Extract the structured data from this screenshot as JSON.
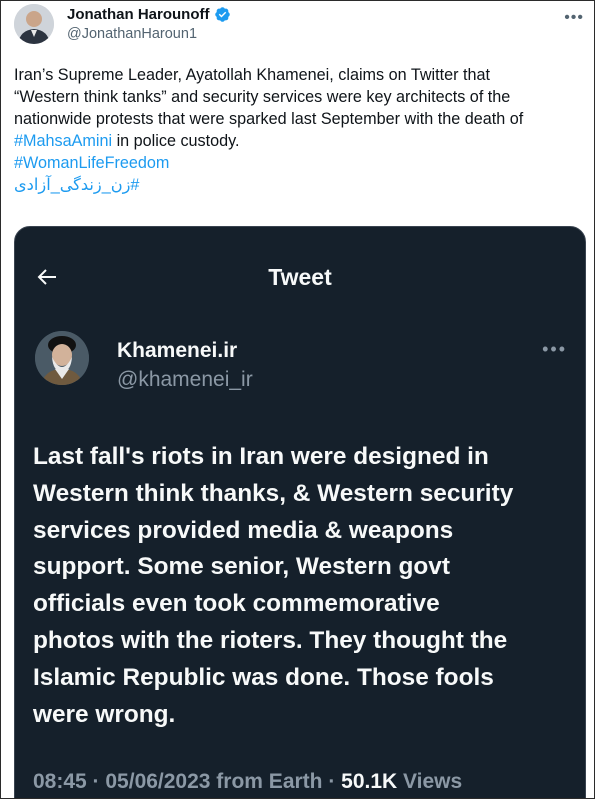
{
  "outer_tweet": {
    "display_name": "Jonathan Harounoff",
    "handle": "@JonathanHaroun1",
    "more_icon": "more-icon",
    "verified_icon": "verified-badge-icon",
    "verified_color": "#1d9bf0",
    "text_lines": [
      "Iran’s Supreme Leader, Ayatollah Khamenei, claims on Twitter that",
      "“Western think tanks” and security services were key architects of the",
      "nationwide protests that were sparked last September with the death of"
    ],
    "line4_hashtag": "#MahsaAmini",
    "line4_rest": " in police custody.",
    "hashtag_2": "#WomanLifeFreedom",
    "hashtag_3": "#زن_زندگی_آزادی"
  },
  "embedded_tweet": {
    "header_title": "Tweet",
    "back_icon": "back-arrow-icon",
    "display_name": "Khamenei.ir",
    "handle": "@khamenei_ir",
    "text_lines": [
      "Last fall's riots in Iran were designed in",
      "Western think thanks, & Western security",
      "services provided media & weapons",
      "support. Some senior, Western govt",
      "officials even took commemorative",
      "photos with the rioters. They thought the",
      "Islamic Republic was done. Those fools",
      "were wrong."
    ],
    "meta_prefix": "08:45 · 05/06/2023 from Earth · ",
    "views_count": "50.1K",
    "views_label": " Views",
    "background_color": "#15202b"
  }
}
